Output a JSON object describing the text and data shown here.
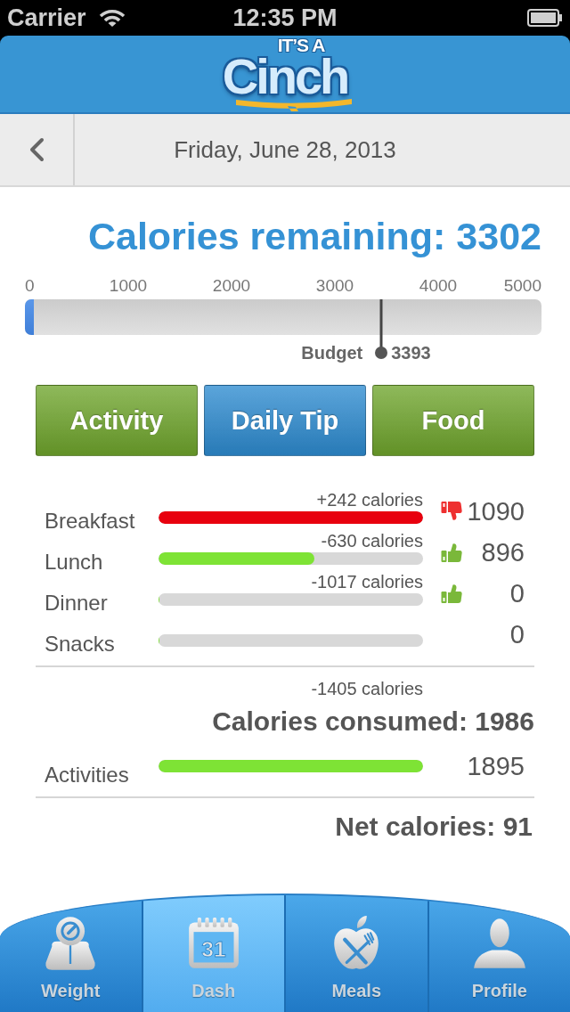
{
  "status_bar": {
    "carrier": "Carrier",
    "time": "12:35 PM"
  },
  "header": {
    "logo_tagline": "IT’S A",
    "logo_word": "Cinch"
  },
  "date_bar": {
    "date": "Friday, June 28, 2013"
  },
  "title": "Calories remaining: 3302",
  "meter": {
    "scale": [
      "0",
      "1000",
      "2000",
      "3000",
      "4000",
      "5000"
    ],
    "level": 0.018,
    "budget": {
      "label": "Budget",
      "value": "3393",
      "level": 0.69
    }
  },
  "buttons": [
    {
      "label": "Activity",
      "color": "#6fa52c"
    },
    {
      "label": "Daily Tip",
      "color": "#2d8bd0"
    },
    {
      "label": "Food",
      "color": "#6fa52c"
    }
  ],
  "meals": [
    {
      "name": "Breakfast",
      "delta": "+242 calories",
      "level": 1,
      "over": true,
      "value": "1090"
    },
    {
      "name": "Lunch",
      "delta": "-630 calories",
      "level": 0.59,
      "over": false,
      "value": "896"
    },
    {
      "name": "Dinner",
      "delta": "-1017 calories",
      "level": 0,
      "over": false,
      "value": "0"
    },
    {
      "name": "Snacks",
      "level": 0,
      "value": "0"
    }
  ],
  "consumed": {
    "delta": "-1405 calories",
    "total": "Calories consumed: 1986"
  },
  "activities": {
    "name": "Activities",
    "level": 1,
    "value": "1895"
  },
  "net": "Net calories: 91",
  "tabs": [
    {
      "label": "Weight",
      "selected": false
    },
    {
      "label": "Dash",
      "selected": true,
      "icon_text": "31"
    },
    {
      "label": "Meals",
      "selected": false
    },
    {
      "label": "Profile",
      "selected": false
    }
  ]
}
